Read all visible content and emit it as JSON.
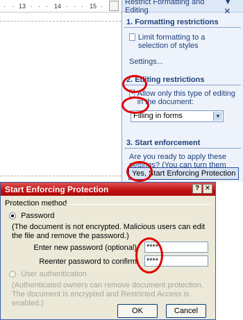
{
  "ruler": {
    "ticks": [
      "13",
      "14",
      "15"
    ]
  },
  "pane": {
    "title": "Restrict Formatting and Editing",
    "close_glyph": "▼ ✕",
    "section1": {
      "title": "1. Formatting restrictions",
      "checkbox_label": "Limit formatting to a selection of styles",
      "settings_link": "Settings..."
    },
    "section2": {
      "title": "2. Editing restrictions",
      "checkbox_label": "Allow only this type of editing in the document:",
      "checked": true,
      "select_value": "Filling in forms"
    },
    "section3": {
      "title": "3. Start enforcement",
      "prompt": "Are you ready to apply these settings? (You can turn them off later)",
      "button_label": "Yes, Start Enforcing Protection"
    }
  },
  "dialog": {
    "title": "Start Enforcing Protection",
    "help_glyph": "?",
    "close_glyph": "✕",
    "group_label": "Protection method",
    "password_option": {
      "label": "Password",
      "selected": true
    },
    "password_note": "(The document is not encrypted. Malicious users can edit the file and remove the password.)",
    "new_password_label": "Enter new password (optional):",
    "new_password_value": "****",
    "confirm_label": "Reenter password to confirm:",
    "confirm_value": "****",
    "user_auth_option": {
      "label": "User authentication",
      "selected": false
    },
    "user_auth_note": "(Authenticated owners can remove document protection. The document is encrypted and Restricted Access is enabled.)",
    "ok_label": "OK",
    "cancel_label": "Cancel"
  },
  "colors": {
    "accent": "#1f3f7a",
    "annotation": "#e00000",
    "dialog_title": "#c01010"
  }
}
